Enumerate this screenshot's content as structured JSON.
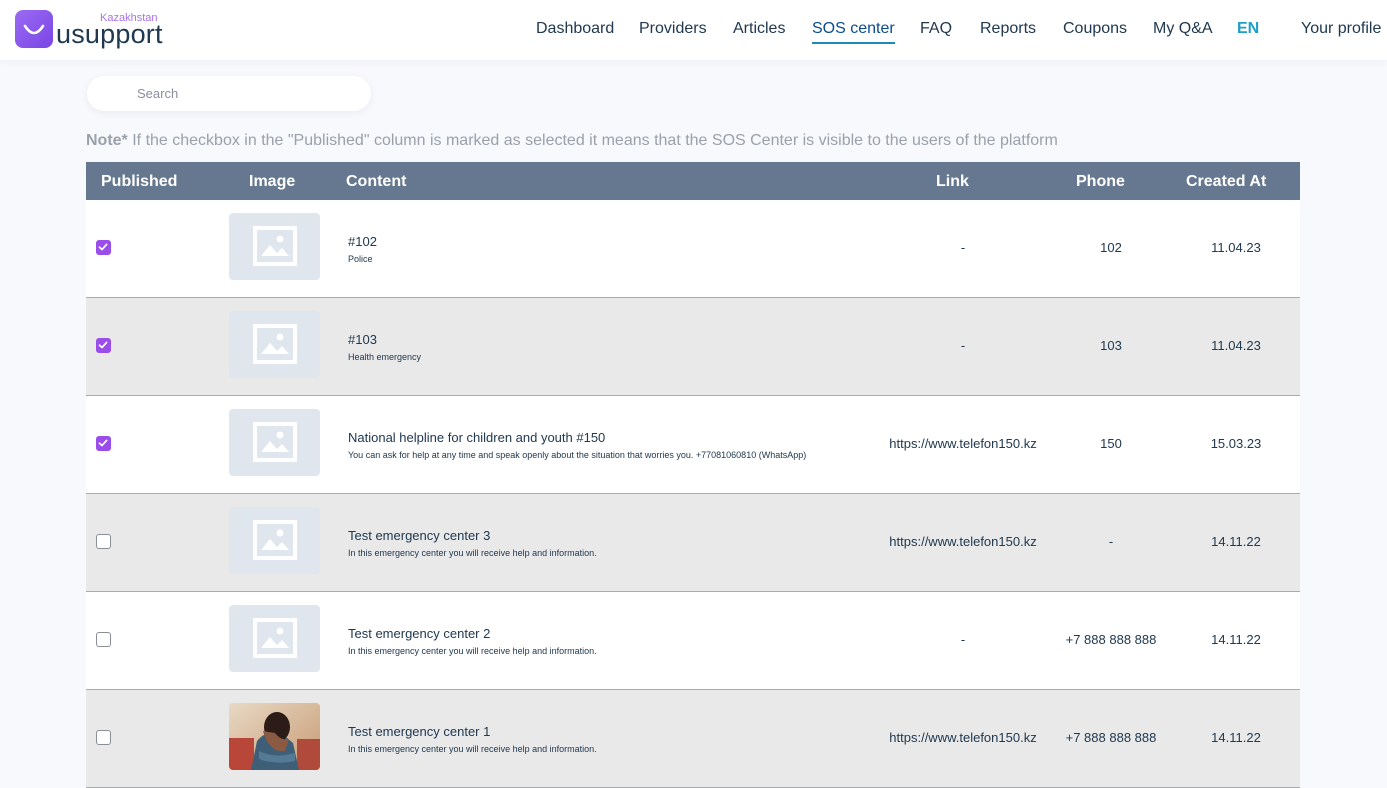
{
  "header": {
    "logo_country": "Kazakhstan",
    "logo_text": "usupport",
    "nav": [
      {
        "label": "Dashboard",
        "active": false
      },
      {
        "label": "Providers",
        "active": false
      },
      {
        "label": "Articles",
        "active": false
      },
      {
        "label": "SOS center",
        "active": true
      },
      {
        "label": "FAQ",
        "active": false
      },
      {
        "label": "Reports",
        "active": false
      },
      {
        "label": "Coupons",
        "active": false
      },
      {
        "label": "My Q&A",
        "active": false
      }
    ],
    "language": "EN",
    "profile": "Your profile"
  },
  "search": {
    "placeholder": "Search",
    "value": ""
  },
  "note": {
    "label": "Note*",
    "text": " If the checkbox in the \"Published\" column is marked as selected it means that the SOS Center is visible to the users of the platform"
  },
  "table": {
    "columns": [
      "Published",
      "Image",
      "Content",
      "Link",
      "Phone",
      "Created At"
    ],
    "rows": [
      {
        "published": true,
        "image": "placeholder-icon",
        "title": "#102",
        "subtitle": "Police",
        "link": "-",
        "phone": "102",
        "created_at": "11.04.23"
      },
      {
        "published": true,
        "image": "placeholder-icon",
        "title": "#103",
        "subtitle": "Health emergency",
        "link": "-",
        "phone": "103",
        "created_at": "11.04.23"
      },
      {
        "published": true,
        "image": "placeholder-icon",
        "title": "National helpline for children and youth #150",
        "subtitle": "You can ask for help at any time and speak openly about the situation that worries you. +77081060810 (WhatsApp)",
        "link": "https://www.telefon150.kz",
        "phone": "150",
        "created_at": "15.03.23"
      },
      {
        "published": false,
        "image": "placeholder-icon",
        "title": "Test emergency center 3",
        "subtitle": "In this emergency center you will receive help and information.",
        "link": "https://www.telefon150.kz",
        "phone": "-",
        "created_at": "14.11.22"
      },
      {
        "published": false,
        "image": "placeholder-icon",
        "title": "Test emergency center 2",
        "subtitle": "In this emergency center you will receive help and information.",
        "link": "-",
        "phone": "+7 888 888 888",
        "created_at": "14.11.22"
      },
      {
        "published": false,
        "image": "photo-person",
        "title": "Test emergency center 1",
        "subtitle": "In this emergency center you will receive help and information.",
        "link": "https://www.telefon150.kz",
        "phone": "+7 888 888 888",
        "created_at": "14.11.22"
      }
    ]
  },
  "colors": {
    "accent_purple": "#9a4de8",
    "table_header": "#66788f",
    "row_alt": "#e9e9ea",
    "nav_active_underline": "#1c8bb8"
  }
}
